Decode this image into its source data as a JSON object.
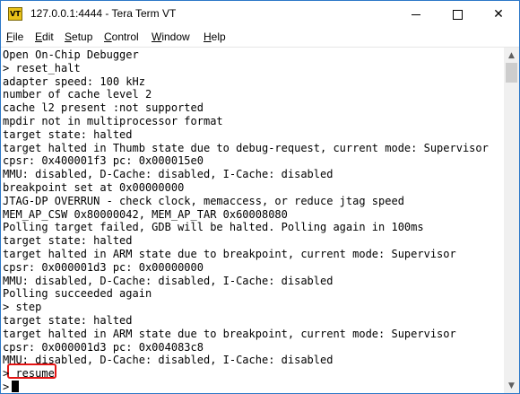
{
  "window": {
    "title": "127.0.0.1:4444 - Tera Term VT",
    "icon_label": "VT",
    "controls": {
      "minimize_icon": "minimize-icon",
      "maximize_icon": "maximize-icon",
      "close_icon": "close-icon",
      "close_glyph": "✕"
    }
  },
  "menu": {
    "items": [
      {
        "label": "File",
        "accel": "F",
        "rest": "ile"
      },
      {
        "label": "Edit",
        "accel": "E",
        "rest": "dit"
      },
      {
        "label": "Setup",
        "accel": "S",
        "rest": "etup"
      },
      {
        "label": "Control",
        "accel": "C",
        "rest": "ontrol"
      },
      {
        "label": "Window",
        "accel": "W",
        "rest": "indow"
      },
      {
        "label": "Help",
        "accel": "H",
        "rest": "elp"
      }
    ]
  },
  "terminal": {
    "lines": [
      "Open On-Chip Debugger",
      "> reset_halt",
      "adapter speed: 100 kHz",
      "number of cache level 2",
      "cache l2 present :not supported",
      "mpdir not in multiprocessor format",
      "target state: halted",
      "target halted in Thumb state due to debug-request, current mode: Supervisor",
      "cpsr: 0x400001f3 pc: 0x000015e0",
      "MMU: disabled, D-Cache: disabled, I-Cache: disabled",
      "breakpoint set at 0x00000000",
      "JTAG-DP OVERRUN - check clock, memaccess, or reduce jtag speed",
      "MEM_AP_CSW 0x80000042, MEM_AP_TAR 0x60008080",
      "Polling target failed, GDB will be halted. Polling again in 100ms",
      "target state: halted",
      "target halted in ARM state due to breakpoint, current mode: Supervisor",
      "cpsr: 0x000001d3 pc: 0x00000000",
      "MMU: disabled, D-Cache: disabled, I-Cache: disabled",
      "Polling succeeded again",
      "> step",
      "target state: halted",
      "target halted in ARM state due to breakpoint, current mode: Supervisor",
      "cpsr: 0x000001d3 pc: 0x004083c8",
      "MMU: disabled, D-Cache: disabled, I-Cache: disabled",
      "> resume",
      ">"
    ],
    "highlight_color": "#e31414"
  },
  "scrollbar": {
    "up_glyph": "▲",
    "down_glyph": "▼"
  }
}
